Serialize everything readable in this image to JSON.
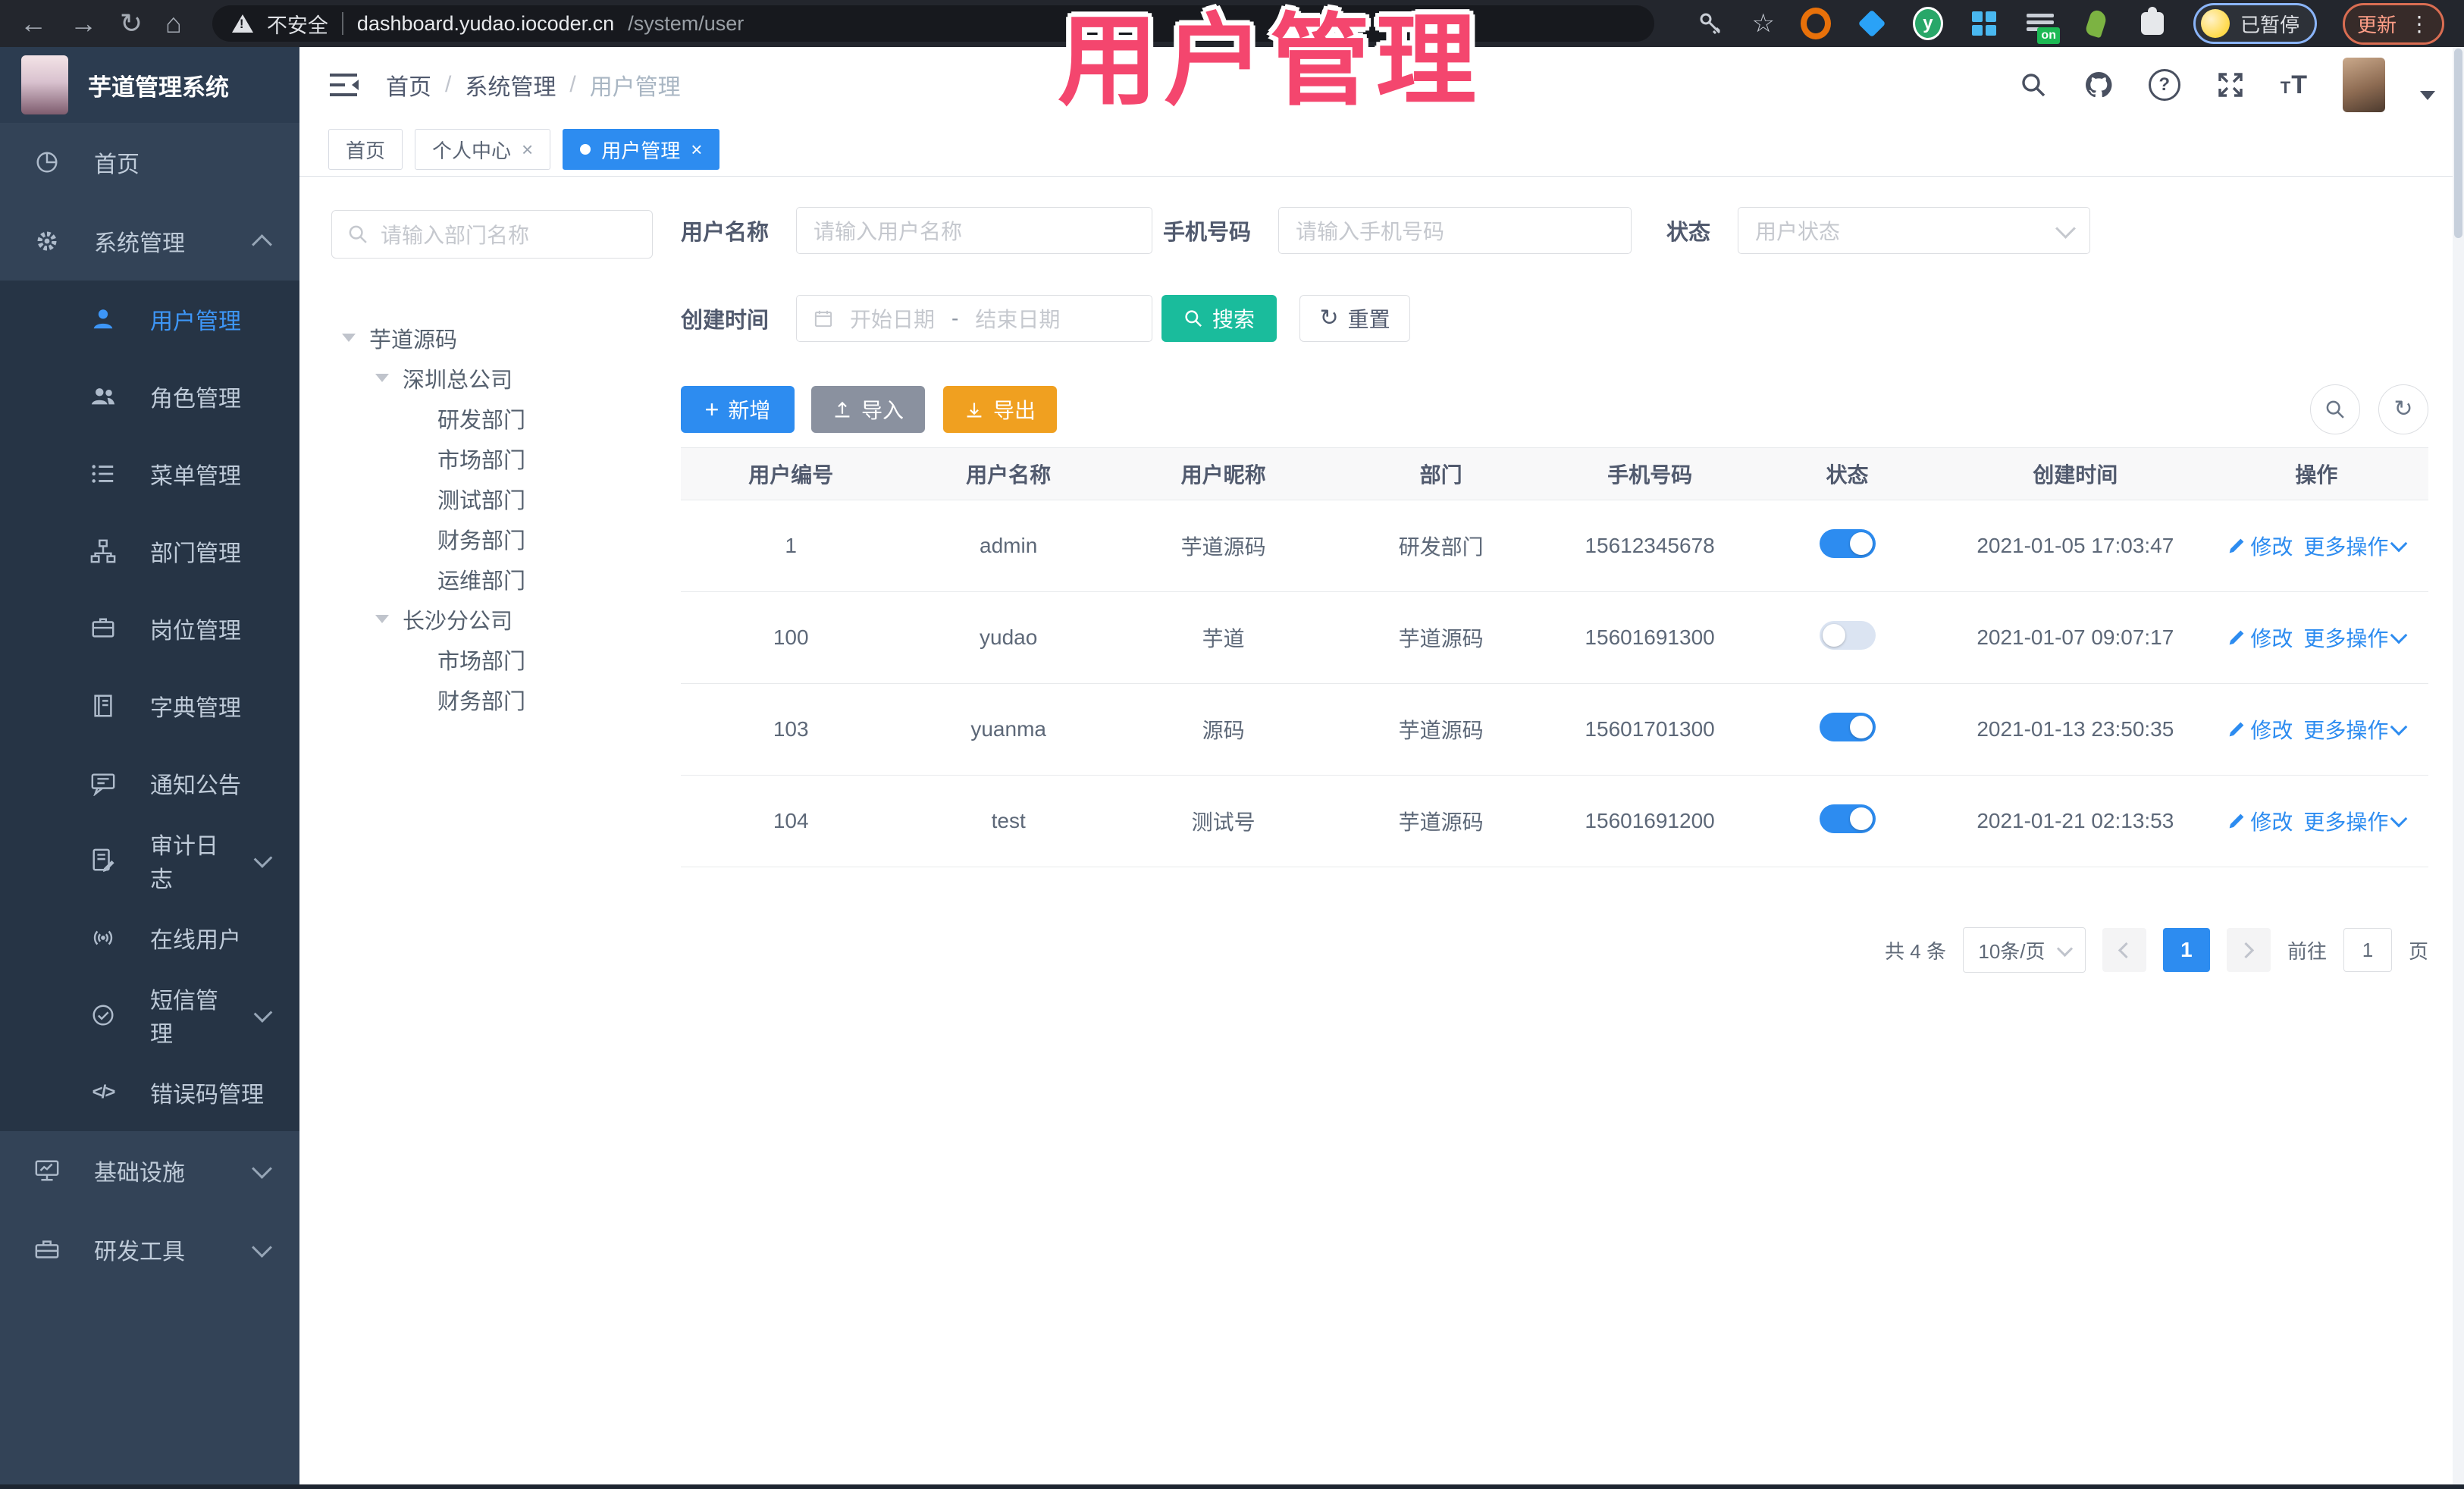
{
  "browser": {
    "security_label": "不安全",
    "url_host": "dashboard.yudao.iocoder.cn",
    "url_path": "/system/user",
    "extension_badge": "on",
    "profile_status_label": "已暂停",
    "update_label": "更新",
    "menu_glyph": "⋮"
  },
  "overlay": {
    "title": "用户管理"
  },
  "app_header": {
    "logo_title": "芋道管理系统",
    "breadcrumb": {
      "items": [
        "首页",
        "系统管理",
        "用户管理"
      ],
      "separator": "/"
    }
  },
  "tabs": {
    "close_glyph": "×",
    "items": [
      {
        "label": "首页"
      },
      {
        "label": "个人中心",
        "closable": true
      },
      {
        "label": "用户管理",
        "closable": true,
        "active": true
      }
    ]
  },
  "sidebar": {
    "items": [
      {
        "label": "首页",
        "icon": "dashboard-icon"
      },
      {
        "label": "系统管理",
        "icon": "gear-icon",
        "expanded": true
      },
      {
        "label": "用户管理",
        "icon": "user-icon",
        "active": true
      },
      {
        "label": "角色管理",
        "icon": "roles-icon"
      },
      {
        "label": "菜单管理",
        "icon": "menu-list-icon"
      },
      {
        "label": "部门管理",
        "icon": "org-tree-icon"
      },
      {
        "label": "岗位管理",
        "icon": "badge-icon"
      },
      {
        "label": "字典管理",
        "icon": "dictionary-icon"
      },
      {
        "label": "通知公告",
        "icon": "announcement-icon"
      },
      {
        "label": "审计日志",
        "icon": "audit-log-icon",
        "collapsible": true
      },
      {
        "label": "在线用户",
        "icon": "online-users-icon"
      },
      {
        "label": "短信管理",
        "icon": "sms-icon",
        "collapsible": true
      },
      {
        "label": "错误码管理",
        "icon": "error-code-icon"
      },
      {
        "label": "基础设施",
        "icon": "infrastructure-icon",
        "collapsible": true
      },
      {
        "label": "研发工具",
        "icon": "dev-tools-icon",
        "collapsible": true
      }
    ]
  },
  "dept_tree": {
    "search_placeholder": "请输入部门名称",
    "root": "芋道源码",
    "children": [
      {
        "label": "深圳总公司",
        "children": [
          "研发部门",
          "市场部门",
          "测试部门",
          "财务部门",
          "运维部门"
        ]
      },
      {
        "label": "长沙分公司",
        "children": [
          "市场部门",
          "财务部门"
        ]
      }
    ]
  },
  "filters": {
    "username_label": "用户名称",
    "username_placeholder": "请输入用户名称",
    "mobile_label": "手机号码",
    "mobile_placeholder": "请输入手机号码",
    "status_label": "状态",
    "status_placeholder": "用户状态",
    "created_label": "创建时间",
    "date_start_placeholder": "开始日期",
    "date_separator": "-",
    "date_end_placeholder": "结束日期",
    "search_label": "搜索",
    "reset_label": "重置"
  },
  "toolbar": {
    "add_label": "新增",
    "import_label": "导入",
    "export_label": "导出"
  },
  "table": {
    "columns": [
      "用户编号",
      "用户名称",
      "用户昵称",
      "部门",
      "手机号码",
      "状态",
      "创建时间",
      "操作"
    ],
    "edit_label": "修改",
    "more_label": "更多操作",
    "rows": [
      {
        "id": "1",
        "username": "admin",
        "nickname": "芋道源码",
        "dept": "研发部门",
        "mobile": "15612345678",
        "status": true,
        "created": "2021-01-05 17:03:47"
      },
      {
        "id": "100",
        "username": "yudao",
        "nickname": "芋道",
        "dept": "芋道源码",
        "mobile": "15601691300",
        "status": false,
        "created": "2021-01-07 09:07:17"
      },
      {
        "id": "103",
        "username": "yuanma",
        "nickname": "源码",
        "dept": "芋道源码",
        "mobile": "15601701300",
        "status": true,
        "created": "2021-01-13 23:50:35"
      },
      {
        "id": "104",
        "username": "test",
        "nickname": "测试号",
        "dept": "芋道源码",
        "mobile": "15601691200",
        "status": true,
        "created": "2021-01-21 02:13:53"
      }
    ]
  },
  "pagination": {
    "total_label": "共 4 条",
    "page_size_label": "10条/页",
    "current_page": "1",
    "goto_label": "前往",
    "goto_value": "1",
    "page_unit_label": "页"
  },
  "colors": {
    "primary_blue": "#2d8cf0",
    "active_menu_text": "#3d96f7",
    "search_teal": "#1abc9c",
    "import_gray": "#8a919f",
    "export_orange": "#f0a020",
    "overlay_pink": "#f4466e",
    "sidebar_bg": "#334357",
    "submenu_bg": "#263445",
    "toggle_on": "#2d8cf0"
  }
}
